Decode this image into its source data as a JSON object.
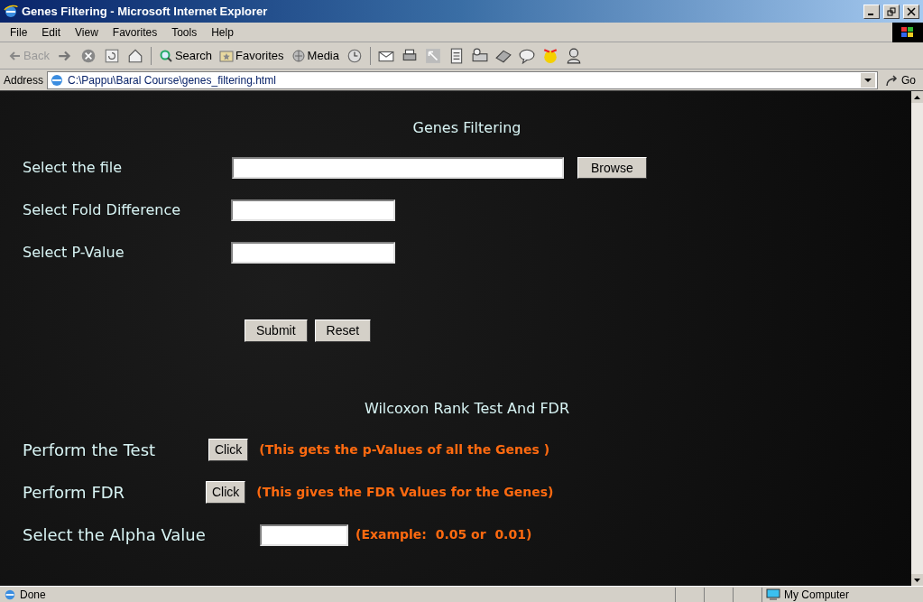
{
  "window": {
    "title": "Genes Filtering - Microsoft Internet Explorer"
  },
  "menu": [
    "File",
    "Edit",
    "View",
    "Favorites",
    "Tools",
    "Help"
  ],
  "toolbar": [
    {
      "kind": "back",
      "label": "Back",
      "disabled": true
    },
    {
      "kind": "search",
      "label": "Search",
      "disabled": false
    },
    {
      "kind": "favorites",
      "label": "Favorites",
      "disabled": false
    },
    {
      "kind": "media",
      "label": "Media",
      "disabled": false
    }
  ],
  "address": {
    "label": "Address",
    "value": "C:\\Pappu\\Baral Course\\genes_filtering.html",
    "go": "Go"
  },
  "page": {
    "heading": "Genes Filtering",
    "file_label": "Select the file",
    "browse": "Browse",
    "fields": [
      {
        "label": "Select Fold Difference"
      },
      {
        "label": "Select P-Value"
      }
    ],
    "buttons": [
      "Submit",
      "Reset"
    ],
    "section_heading": "Wilcoxon Rank Test And FDR",
    "actions": [
      {
        "label": "Perform the Test",
        "button": "Click",
        "note": "(This gets the p-Values of all the Genes )"
      },
      {
        "label": "Perform FDR",
        "button": "Click",
        "note": "(This gives the FDR Values for the Genes)"
      }
    ],
    "alpha": {
      "label": "Select the Alpha Value",
      "note": "(Example:  0.05 or  0.01)"
    }
  },
  "status_bar": {
    "text": "Done",
    "zone": "My Computer"
  }
}
